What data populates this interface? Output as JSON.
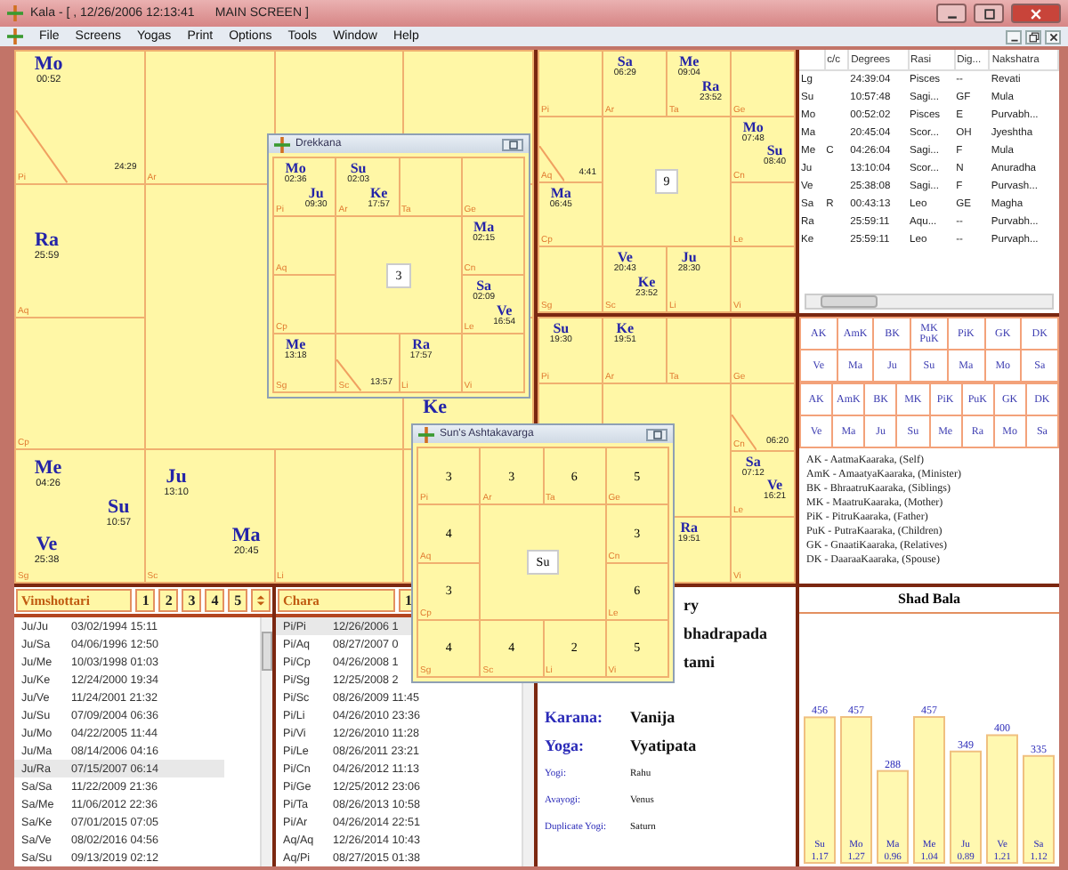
{
  "window": {
    "title": "Kala - [ , 12/26/2006 12:13:41      MAIN SCREEN ]"
  },
  "menu": [
    "File",
    "Screens",
    "Yogas",
    "Print",
    "Options",
    "Tools",
    "Window",
    "Help"
  ],
  "main_chart": {
    "cells": [
      {
        "sign": "Pi",
        "lagna_degree": "24:29",
        "planets": [
          {
            "name": "Mo",
            "degree": "00:52"
          }
        ]
      },
      {
        "sign": "Ar"
      },
      null,
      null,
      {
        "sign": "Aq",
        "planets": [
          {
            "name": "Ra",
            "degree": "25:59"
          }
        ]
      },
      null,
      {
        "sign": "Cp"
      },
      {
        "planets": [
          {
            "name": "Ke"
          }
        ]
      },
      {
        "sign": "Sg",
        "planets": [
          {
            "name": "Me",
            "degree": "04:26"
          },
          {
            "name": "Su",
            "degree": "10:57"
          },
          {
            "name": "Ve",
            "degree": "25:38"
          }
        ]
      },
      {
        "sign": "Sc",
        "planets": [
          {
            "name": "Ju",
            "degree": "13:10"
          },
          {
            "name": "Ma",
            "degree": "20:45"
          }
        ]
      },
      {
        "sign": "Li"
      },
      null
    ]
  },
  "rasi_chart": {
    "center": "9",
    "cells": [
      {
        "sign": "Pi"
      },
      {
        "sign": "Ar",
        "planets": [
          {
            "name": "Sa",
            "degree": "06:29"
          }
        ]
      },
      {
        "sign": "Ta",
        "planets": [
          {
            "name": "Me",
            "degree": "09:04"
          },
          {
            "name": "Ra",
            "degree": "23:52"
          }
        ]
      },
      {
        "sign": "Ge"
      },
      {
        "sign": "Aq",
        "lagna_degree": "4:41"
      },
      {
        "sign": "Cn",
        "planets": [
          {
            "name": "Mo",
            "degree": "07:48"
          },
          {
            "name": "Su",
            "degree": "08:40"
          }
        ]
      },
      {
        "sign": "Cp",
        "planets": [
          {
            "name": "Ma",
            "degree": "06:45"
          }
        ]
      },
      {
        "sign": "Le"
      },
      {
        "sign": "Sg"
      },
      {
        "sign": "Sc",
        "planets": [
          {
            "name": "Ve",
            "degree": "20:43"
          },
          {
            "name": "Ke",
            "degree": "23:52"
          }
        ]
      },
      {
        "sign": "Li",
        "planets": [
          {
            "name": "Ju",
            "degree": "28:30"
          }
        ]
      },
      {
        "sign": "Vi"
      }
    ]
  },
  "planet_table": {
    "columns": [
      "c/c",
      "Degrees",
      "Rasi",
      "Dig...",
      "Nakshatra"
    ],
    "rows": [
      {
        "planet": "Lg",
        "degrees": "24:39:04",
        "rasi": "Pisces",
        "dignity": "--",
        "nakshatra": "Revati"
      },
      {
        "planet": "Su",
        "degrees": "10:57:48",
        "rasi": "Sagi...",
        "dignity": "GF",
        "nakshatra": "Mula"
      },
      {
        "planet": "Mo",
        "degrees": "00:52:02",
        "rasi": "Pisces",
        "dignity": "E",
        "nakshatra": "Purvabh..."
      },
      {
        "planet": "Ma",
        "degrees": "20:45:04",
        "rasi": "Scor...",
        "dignity": "OH",
        "nakshatra": "Jyeshtha"
      },
      {
        "planet": "Me",
        "cc": "C",
        "degrees": "04:26:04",
        "rasi": "Sagi...",
        "dignity": "F",
        "nakshatra": "Mula"
      },
      {
        "planet": "Ju",
        "degrees": "13:10:04",
        "rasi": "Scor...",
        "dignity": "N",
        "nakshatra": "Anuradha"
      },
      {
        "planet": "Ve",
        "degrees": "25:38:08",
        "rasi": "Sagi...",
        "dignity": "F",
        "nakshatra": "Purvash..."
      },
      {
        "planet": "Sa",
        "cc": "R",
        "degrees": "00:43:13",
        "rasi": "Leo",
        "dignity": "GE",
        "nakshatra": "Magha"
      },
      {
        "planet": "Ra",
        "degrees": "25:59:11",
        "rasi": "Aqu...",
        "dignity": "--",
        "nakshatra": "Purvabh..."
      },
      {
        "planet": "Ke",
        "degrees": "25:59:11",
        "rasi": "Leo",
        "dignity": "--",
        "nakshatra": "Purvaph..."
      }
    ]
  },
  "navamsa_chart": {
    "cells": [
      {
        "sign": "Pi",
        "planets": [
          {
            "name": "Su",
            "degree": "19:30"
          }
        ]
      },
      {
        "sign": "Ar",
        "planets": [
          {
            "name": "Ke",
            "degree": "19:51"
          }
        ]
      },
      {
        "sign": "Ta"
      },
      {
        "sign": "Ge"
      },
      null,
      {
        "sign": "Cn",
        "lagna_degree": "06:20"
      },
      null,
      {
        "sign": "Le",
        "planets": [
          {
            "name": "Sa",
            "degree": "07:12"
          },
          {
            "name": "Ve",
            "degree": "16:21"
          }
        ]
      },
      null,
      null,
      {
        "planets": [
          {
            "name": "Ra",
            "degree": "19:51"
          }
        ]
      },
      {
        "sign": "Vi"
      }
    ]
  },
  "karakas": {
    "tables": [
      {
        "headers": [
          "AK",
          "AmK",
          "BK",
          "MK\nPuK",
          "PiK",
          "GK",
          "DK"
        ],
        "values": [
          "Ve",
          "Ma",
          "Ju",
          "Su",
          "Ma",
          "Mo",
          "Sa"
        ]
      },
      {
        "headers": [
          "AK",
          "AmK",
          "BK",
          "MK",
          "PiK",
          "PuK",
          "GK",
          "DK"
        ],
        "values": [
          "Ve",
          "Ma",
          "Ju",
          "Su",
          "Me",
          "Ra",
          "Mo",
          "Sa"
        ]
      }
    ],
    "legend": [
      "AK - AatmaKaaraka, (Self)",
      "AmK - AmaatyaKaaraka, (Minister)",
      "BK - BhraatruKaaraka, (Siblings)",
      "MK - MaatruKaaraka, (Mother)",
      "PiK - PitruKaaraka, (Father)",
      "PuK - PutraKaaraka, (Children)",
      "GK - GnaatiKaaraka, (Relatives)",
      "DK - DaaraaKaaraka, (Spouse)"
    ]
  },
  "vimshottari": {
    "title": "Vimshottari",
    "buttons": [
      "1",
      "2",
      "3",
      "4",
      "5"
    ],
    "rows": [
      {
        "period": "Ju/Ju",
        "start": "03/02/1994 15:11",
        "selected": false
      },
      {
        "period": "Ju/Sa",
        "start": "04/06/1996 12:50",
        "selected": false
      },
      {
        "period": "Ju/Me",
        "start": "10/03/1998 01:03",
        "selected": false
      },
      {
        "period": "Ju/Ke",
        "start": "12/24/2000 19:34",
        "selected": false
      },
      {
        "period": "Ju/Ve",
        "start": "11/24/2001 21:32",
        "selected": false
      },
      {
        "period": "Ju/Su",
        "start": "07/09/2004 06:36",
        "selected": false
      },
      {
        "period": "Ju/Mo",
        "start": "04/22/2005 11:44",
        "selected": false
      },
      {
        "period": "Ju/Ma",
        "start": "08/14/2006 04:16",
        "selected": false
      },
      {
        "period": "Ju/Ra",
        "start": "07/15/2007 06:14",
        "selected": true
      },
      {
        "period": "Sa/Sa",
        "start": "11/22/2009 21:36",
        "selected": false
      },
      {
        "period": "Sa/Me",
        "start": "11/06/2012 22:36",
        "selected": false
      },
      {
        "period": "Sa/Ke",
        "start": "07/01/2015 07:05",
        "selected": false
      },
      {
        "period": "Sa/Ve",
        "start": "08/02/2016 04:56",
        "selected": false
      },
      {
        "period": "Sa/Su",
        "start": "09/13/2019 02:12",
        "selected": false
      }
    ]
  },
  "chara": {
    "title": "Chara",
    "buttons": [
      "1"
    ],
    "rows": [
      {
        "period": "Pi/Pi",
        "start": "12/26/2006 1",
        "selected": true
      },
      {
        "period": "Pi/Aq",
        "start": "08/27/2007 0",
        "selected": false
      },
      {
        "period": "Pi/Cp",
        "start": "04/26/2008 1",
        "selected": false
      },
      {
        "period": "Pi/Sg",
        "start": "12/25/2008 2",
        "selected": false
      },
      {
        "period": "Pi/Sc",
        "start": "08/26/2009 11:45",
        "selected": false
      },
      {
        "period": "Pi/Li",
        "start": "04/26/2010 23:36",
        "selected": false
      },
      {
        "period": "Pi/Vi",
        "start": "12/26/2010 11:28",
        "selected": false
      },
      {
        "period": "Pi/Le",
        "start": "08/26/2011 23:21",
        "selected": false
      },
      {
        "period": "Pi/Cn",
        "start": "04/26/2012 11:13",
        "selected": false
      },
      {
        "period": "Pi/Ge",
        "start": "12/25/2012 23:06",
        "selected": false
      },
      {
        "period": "Pi/Ta",
        "start": "08/26/2013 10:58",
        "selected": false
      },
      {
        "period": "Pi/Ar",
        "start": "04/26/2014 22:51",
        "selected": false
      },
      {
        "period": "Aq/Aq",
        "start": "12/26/2014 10:43",
        "selected": false
      },
      {
        "period": "Aq/Pi",
        "start": "08/27/2015 01:38",
        "selected": false
      }
    ]
  },
  "panchang": {
    "rows": [
      {
        "kind": "partial",
        "value": "ry"
      },
      {
        "kind": "partial",
        "value": "bhadrapada"
      },
      {
        "kind": "partial",
        "value": "tami"
      },
      {
        "kind": "major",
        "label": "Karana:",
        "value": "Vanija"
      },
      {
        "kind": "major",
        "label": "Yoga:",
        "value": "Vyatipata"
      },
      {
        "kind": "minor",
        "label": "Yogi:",
        "value": "Rahu"
      },
      {
        "kind": "minor",
        "label": "Avayogi:",
        "value": "Venus"
      },
      {
        "kind": "minor",
        "label": "Duplicate Yogi:",
        "value": "Saturn"
      }
    ]
  },
  "shad_bala": {
    "ratios": [
      "1.17",
      "1.27",
      "0.96",
      "1.04",
      "0.89",
      "1.21",
      "1.12"
    ],
    "chart_data": {
      "type": "bar",
      "title": "Shad Bala",
      "categories": [
        "Su",
        "Mo",
        "Ma",
        "Me",
        "Ju",
        "Ve",
        "Sa"
      ],
      "series": [
        {
          "color": "#fff8b0",
          "values": [
            456,
            457,
            288,
            457,
            349,
            400,
            335
          ]
        }
      ],
      "data_labels": true
    }
  },
  "drekkana_window": {
    "title": "Drekkana",
    "center": "3",
    "cells": [
      {
        "sign": "Pi",
        "planets": [
          {
            "name": "Mo",
            "degree": "02:36"
          },
          {
            "name": "Ju",
            "degree": "09:30"
          }
        ]
      },
      {
        "sign": "Ar",
        "planets": [
          {
            "name": "Su",
            "degree": "02:03"
          },
          {
            "name": "Ke",
            "degree": "17:57"
          }
        ]
      },
      {
        "sign": "Ta"
      },
      {
        "sign": "Ge"
      },
      {
        "sign": "Aq"
      },
      {
        "sign": "Cn",
        "planets": [
          {
            "name": "Ma",
            "degree": "02:15"
          }
        ]
      },
      {
        "sign": "Cp"
      },
      {
        "sign": "Le",
        "planets": [
          {
            "name": "Sa",
            "degree": "02:09"
          },
          {
            "name": "Ve",
            "degree": "16:54"
          }
        ]
      },
      {
        "sign": "Sg",
        "planets": [
          {
            "name": "Me",
            "degree": "13:18"
          }
        ]
      },
      {
        "sign": "Sc",
        "lagna_degree": "13:57"
      },
      {
        "sign": "Li",
        "planets": [
          {
            "name": "Ra",
            "degree": "17:57"
          }
        ]
      },
      {
        "sign": "Vi"
      }
    ]
  },
  "ashtakavarga_window": {
    "title": "Sun's Ashtakavarga",
    "center": "Su",
    "cells": [
      {
        "sign": "Pi",
        "value": "3"
      },
      {
        "sign": "Ar",
        "value": "3"
      },
      {
        "sign": "Ta",
        "value": "6"
      },
      {
        "sign": "Ge",
        "value": "5"
      },
      {
        "sign": "Aq",
        "value": "4"
      },
      {
        "sign": "Cn",
        "value": "3"
      },
      {
        "sign": "Cp",
        "value": "3"
      },
      {
        "sign": "Le",
        "value": "6"
      },
      {
        "sign": "Sg",
        "value": "4"
      },
      {
        "sign": "Sc",
        "value": "4"
      },
      {
        "sign": "Li",
        "value": "2"
      },
      {
        "sign": "Vi",
        "value": "5"
      }
    ]
  }
}
